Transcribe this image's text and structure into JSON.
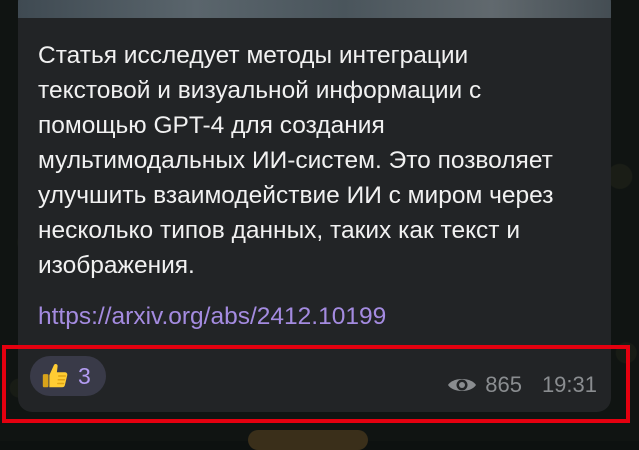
{
  "message": {
    "text": "Статья исследует методы интеграции\nтекстовой и визуальной информации с\nпомощью GPT-4 для создания\nмультимодальных ИИ-систем. Это позволяет\nулучшить взаимодействие ИИ с миром через\nнесколько типов данных, таких как текст и\nизображения.",
    "link": "https://arxiv.org/abs/2412.10199"
  },
  "reaction": {
    "emoji_icon": "thumbs-up-icon",
    "count": "3"
  },
  "meta": {
    "views_icon": "eye-icon",
    "views": "865",
    "time": "19:31"
  },
  "colors": {
    "bubble_bg": "#222426",
    "text": "#f1f1f1",
    "link": "#a48be0",
    "reaction_bg": "#393a48",
    "reaction_count": "#b39cf2",
    "meta": "#8a8d90",
    "highlight": "#e4000f"
  }
}
